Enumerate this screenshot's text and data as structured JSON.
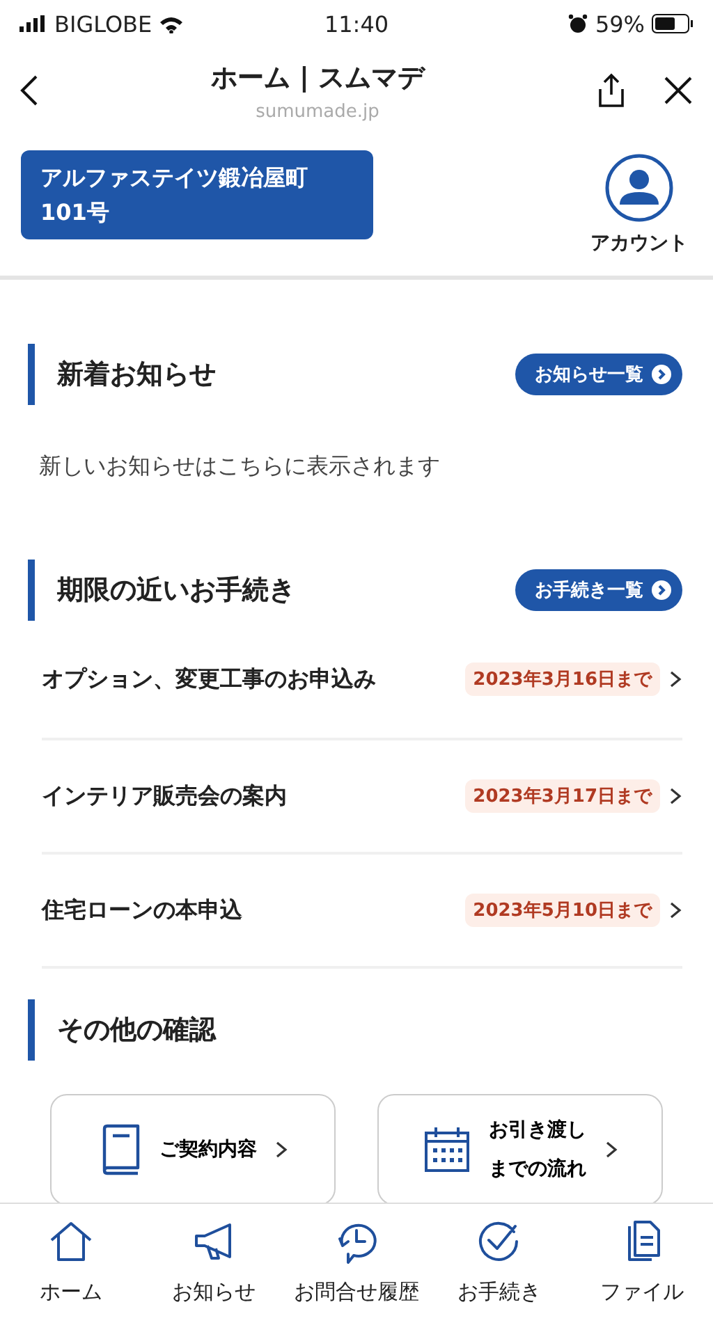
{
  "status_bar": {
    "carrier": "BIGLOBE",
    "time": "11:40",
    "battery": "59%"
  },
  "browser": {
    "title": "ホーム | スムマデ",
    "url": "sumumade.jp"
  },
  "property": {
    "name": "アルファステイツ鍛冶屋町\n101号",
    "account_label": "アカウント"
  },
  "news": {
    "title": "新着お知らせ",
    "link": "お知らせ一覧",
    "empty_message": "新しいお知らせはこちらに表示されます"
  },
  "procedures": {
    "title": "期限の近いお手続き",
    "link": "お手続き一覧",
    "items": [
      {
        "name": "オプション、変更工事のお申込み",
        "deadline": "2023年3月16日まで"
      },
      {
        "name": "インテリア販売会の案内",
        "deadline": "2023年3月17日まで"
      },
      {
        "name": "住宅ローンの本申込",
        "deadline": "2023年5月10日まで"
      }
    ]
  },
  "other": {
    "title": "その他の確認",
    "cards": [
      {
        "kind": "book",
        "label": "ご契約内容"
      },
      {
        "kind": "calendar",
        "label": "お引き渡しまでの流れ"
      }
    ]
  },
  "tab_bar": [
    {
      "kind": "home",
      "label": "ホーム"
    },
    {
      "kind": "megaphone",
      "label": "お知らせ"
    },
    {
      "kind": "history",
      "label": "お問合せ履歴"
    },
    {
      "kind": "check",
      "label": "お手続き"
    },
    {
      "kind": "file",
      "label": "ファイル"
    }
  ]
}
